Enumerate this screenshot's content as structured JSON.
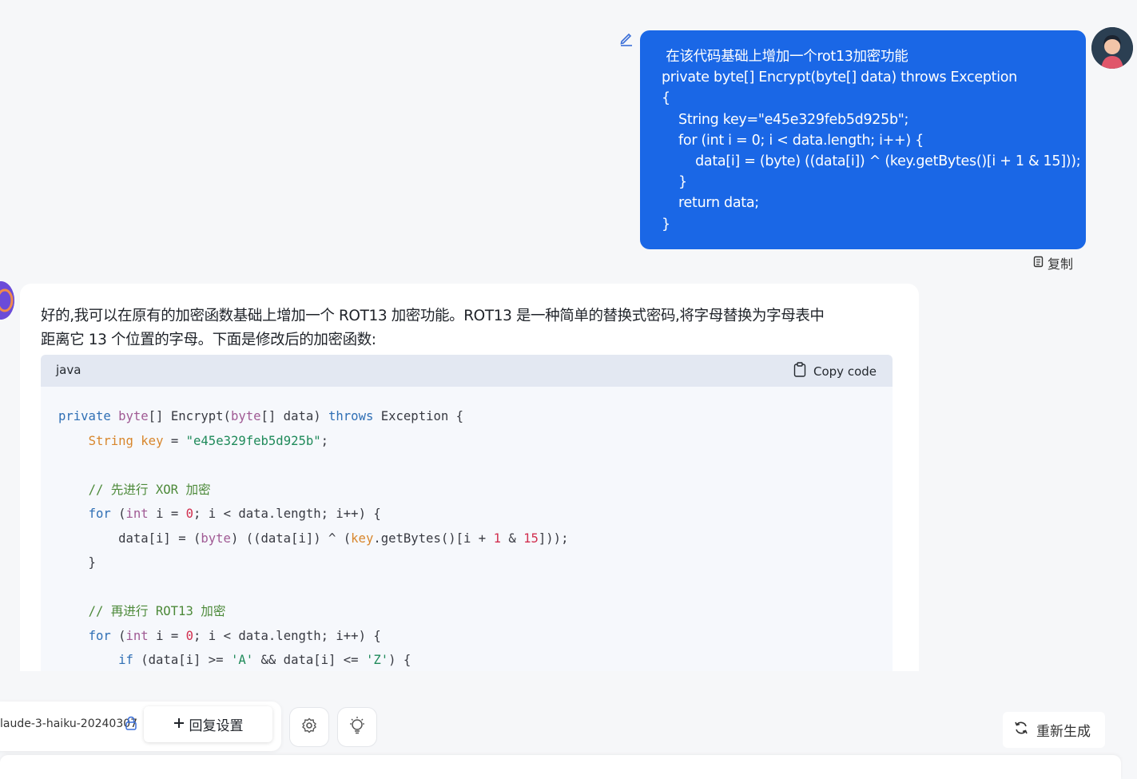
{
  "user_message": {
    "lines": [
      " 在该代码基础上增加一个rot13加密功能",
      "private byte[] Encrypt(byte[] data) throws Exception",
      "{",
      "    String key=\"e45e329feb5d925b\";",
      "    for (int i = 0; i < data.length; i++) {",
      "        data[i] = (byte) ((data[i]) ^ (key.getBytes()[i + 1 & 15]));",
      "    }",
      "    return data;",
      "}"
    ],
    "copy_label": "复制",
    "bubble_color": "#1a67e6"
  },
  "assistant_message": {
    "intro_line1": "好的,我可以在原有的加密函数基础上增加一个 ROT13 加密功能。ROT13 是一种简单的替换式密码,将字母替换为字母表中",
    "intro_line2": "距离它 13 个位置的字母。下面是修改后的加密函数:",
    "code_block": {
      "language": "java",
      "copy_label": "Copy code",
      "lines": [
        "private byte[] Encrypt(byte[] data) throws Exception {",
        "    String key = \"e45e329feb5d925b\";",
        "",
        "    // 先进行 XOR 加密",
        "    for (int i = 0; i < data.length; i++) {",
        "        data[i] = (byte) ((data[i]) ^ (key.getBytes()[i + 1 & 15]));",
        "    }",
        "",
        "    // 再进行 ROT13 加密",
        "    for (int i = 0; i < data.length; i++) {",
        "        if (data[i] >= 'A' && data[i] <= 'Z') {"
      ]
    }
  },
  "toolbar": {
    "model_name": "laude-3-haiku-20240307",
    "reply_settings_label": "回复设置",
    "regenerate_label": "重新生成"
  },
  "icons": {
    "edit": "pencil-icon",
    "copy": "clipboard-icon",
    "lock": "lock-icon",
    "plus": "plus-icon",
    "settings": "gear-icon",
    "ai_idea": "lightbulb-icon",
    "regenerate": "refresh-icon"
  }
}
